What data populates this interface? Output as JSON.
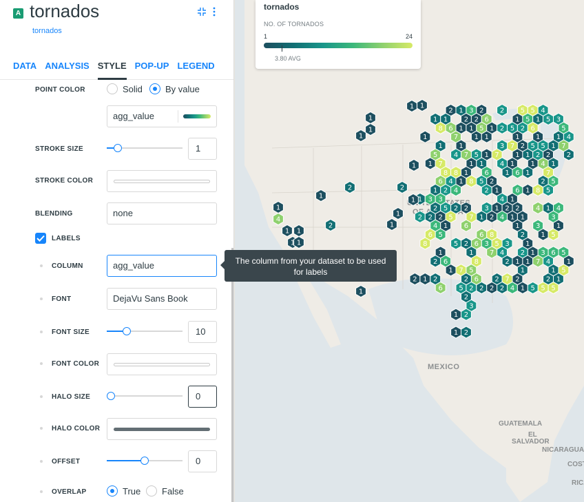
{
  "panel": {
    "layer_badge": "A",
    "layer_title": "tornados",
    "layer_subtitle": "tornados",
    "header_icons": [
      "collapse-icon",
      "more-vertical-icon"
    ],
    "tabs": [
      {
        "label": "DATA",
        "active": false
      },
      {
        "label": "ANALYSIS",
        "active": false
      },
      {
        "label": "STYLE",
        "active": true
      },
      {
        "label": "POP-UP",
        "active": false
      },
      {
        "label": "LEGEND",
        "active": false
      }
    ]
  },
  "style": {
    "point_color": {
      "label": "POINT COLOR",
      "option_solid": "Solid",
      "option_by_value": "By value",
      "selected": "By value",
      "field": "agg_value"
    },
    "stroke_size": {
      "label": "STROKE SIZE",
      "value": "1",
      "fraction": 0.1
    },
    "stroke_color": {
      "label": "STROKE COLOR",
      "color": "#ffffff"
    },
    "blending": {
      "label": "BLENDING",
      "value": "none"
    },
    "labels": {
      "label": "LABELS",
      "checked": true,
      "column": {
        "label": "COLUMN",
        "value": "agg_value"
      },
      "font": {
        "label": "FONT",
        "value": "DejaVu Sans Book"
      },
      "font_size": {
        "label": "FONT SIZE",
        "value": "10",
        "fraction": 0.23
      },
      "font_color": {
        "label": "FONT COLOR",
        "color": "#ffffff"
      },
      "halo_size": {
        "label": "HALO SIZE",
        "value": "0",
        "fraction": 0.0
      },
      "halo_color": {
        "label": "HALO COLOR",
        "color": "#636e74"
      },
      "offset": {
        "label": "OFFSET",
        "value": "0",
        "fraction": 0.5
      },
      "overlap": {
        "label": "OVERLAP",
        "option_true": "True",
        "option_false": "False",
        "selected": "True"
      }
    }
  },
  "tooltip": {
    "text": "The column from your dataset to be used for labels"
  },
  "legend": {
    "title": "tornados",
    "subtitle": "NO. OF TORNADOS",
    "min": "1",
    "max": "24",
    "avg_label": "3.80 AVG",
    "avg_value": 3.8
  },
  "map": {
    "labels": [
      "UNITED STATES",
      "OF AMERICA",
      "MEXICO",
      "GUATEMALA",
      "EL",
      "SALVADOR",
      "NICARAGUA",
      "COSTA",
      "RICA"
    ],
    "ramp": [
      "#1d4f5f",
      "#126f74",
      "#19968a",
      "#3cb87b",
      "#8fd16e",
      "#d7ea67"
    ]
  }
}
